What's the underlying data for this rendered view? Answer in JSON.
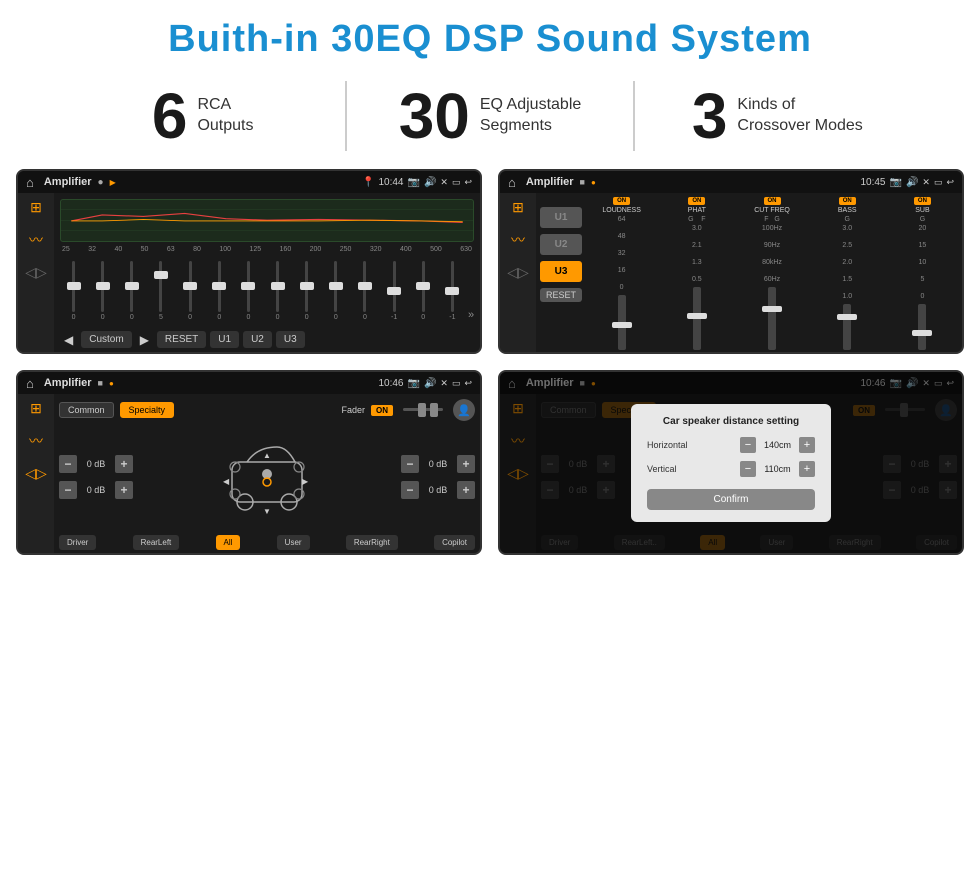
{
  "title": "Buith-in 30EQ DSP Sound System",
  "stats": [
    {
      "number": "6",
      "label_line1": "RCA",
      "label_line2": "Outputs"
    },
    {
      "number": "30",
      "label_line1": "EQ Adjustable",
      "label_line2": "Segments"
    },
    {
      "number": "3",
      "label_line1": "Kinds of",
      "label_line2": "Crossover Modes"
    }
  ],
  "screens": {
    "eq_screen": {
      "title": "Amplifier",
      "time": "10:44",
      "freqs": [
        "25",
        "32",
        "40",
        "50",
        "63",
        "80",
        "100",
        "125",
        "160",
        "200",
        "250",
        "320",
        "400",
        "500",
        "630"
      ],
      "vals": [
        "0",
        "0",
        "0",
        "5",
        "0",
        "0",
        "0",
        "0",
        "0",
        "0",
        "0",
        "-1",
        "0",
        "-1"
      ],
      "preset": "Custom",
      "buttons": [
        "RESET",
        "U1",
        "U2",
        "U3"
      ]
    },
    "mixer_screen": {
      "title": "Amplifier",
      "time": "10:45",
      "u_buttons": [
        "U1",
        "U2",
        "U3"
      ],
      "active_u": "U3",
      "channels": [
        "LOUDNESS",
        "PHAT",
        "CUT FREQ",
        "BASS",
        "SUB"
      ],
      "reset_label": "RESET"
    },
    "fader_screen": {
      "title": "Amplifier",
      "time": "10:46",
      "tabs": [
        "Common",
        "Specialty"
      ],
      "active_tab": "Specialty",
      "fader_label": "Fader",
      "on_label": "ON",
      "db_values": [
        "0 dB",
        "0 dB",
        "0 dB",
        "0 dB"
      ],
      "bottom_btns": [
        "Driver",
        "RearLeft",
        "All",
        "User",
        "RearRight",
        "Copilot"
      ]
    },
    "dialog_screen": {
      "title": "Amplifier",
      "time": "10:46",
      "tabs": [
        "Common",
        "Specialty"
      ],
      "active_tab": "Specialty",
      "dialog_title": "Car speaker distance setting",
      "horizontal_label": "Horizontal",
      "horizontal_val": "140cm",
      "vertical_label": "Vertical",
      "vertical_val": "110cm",
      "confirm_label": "Confirm",
      "db_values": [
        "0 dB",
        "0 dB"
      ],
      "bottom_btns": [
        "Driver",
        "RearLeft..",
        "User",
        "RearRight",
        "Copilot"
      ]
    }
  }
}
